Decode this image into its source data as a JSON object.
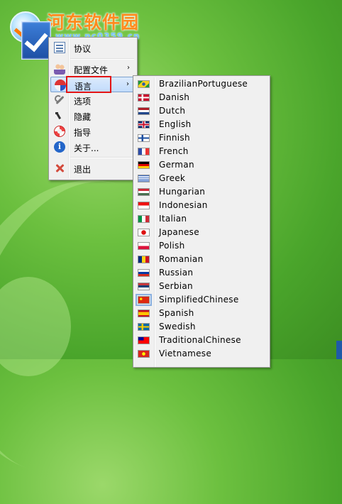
{
  "watermark": {
    "site_name": "河东软件园",
    "url": "www.pc0359.cn"
  },
  "context_menu": {
    "items": [
      {
        "label": "协议",
        "icon": "document-icon"
      },
      {
        "label": "配置文件",
        "icon": "users-icon",
        "has_submenu": true
      },
      {
        "label": "语言",
        "icon": "language-icon",
        "has_submenu": true,
        "active": true
      },
      {
        "label": "选项",
        "icon": "wrench-icon"
      },
      {
        "label": "隐藏",
        "icon": "hide-icon"
      },
      {
        "label": "指导",
        "icon": "help-icon"
      },
      {
        "label": "关于...",
        "icon": "info-icon"
      },
      {
        "label": "退出",
        "icon": "exit-icon"
      }
    ],
    "submenu_arrow": "›"
  },
  "language_submenu": {
    "items": [
      {
        "label": "BrazilianPortuguese",
        "flag": "brazil"
      },
      {
        "label": "Danish",
        "flag": "denmark"
      },
      {
        "label": "Dutch",
        "flag": "netherlands"
      },
      {
        "label": "English",
        "flag": "united-kingdom"
      },
      {
        "label": "Finnish",
        "flag": "finland"
      },
      {
        "label": "French",
        "flag": "france"
      },
      {
        "label": "German",
        "flag": "germany"
      },
      {
        "label": "Greek",
        "flag": "greece"
      },
      {
        "label": "Hungarian",
        "flag": "hungary"
      },
      {
        "label": "Indonesian",
        "flag": "indonesia"
      },
      {
        "label": "Italian",
        "flag": "italy"
      },
      {
        "label": "Japanese",
        "flag": "japan"
      },
      {
        "label": "Polish",
        "flag": "poland"
      },
      {
        "label": "Romanian",
        "flag": "romania"
      },
      {
        "label": "Russian",
        "flag": "russia"
      },
      {
        "label": "Serbian",
        "flag": "serbia"
      },
      {
        "label": "SimplifiedChinese",
        "flag": "china",
        "selected": true
      },
      {
        "label": "Spanish",
        "flag": "spain"
      },
      {
        "label": "Swedish",
        "flag": "sweden"
      },
      {
        "label": "TraditionalChinese",
        "flag": "taiwan"
      },
      {
        "label": "Vietnamese",
        "flag": "vietnam"
      }
    ]
  },
  "colors": {
    "highlight_box": "#e31414",
    "desktop_green": "#6cc03f",
    "watermark_orange": "#ff8a1c"
  }
}
